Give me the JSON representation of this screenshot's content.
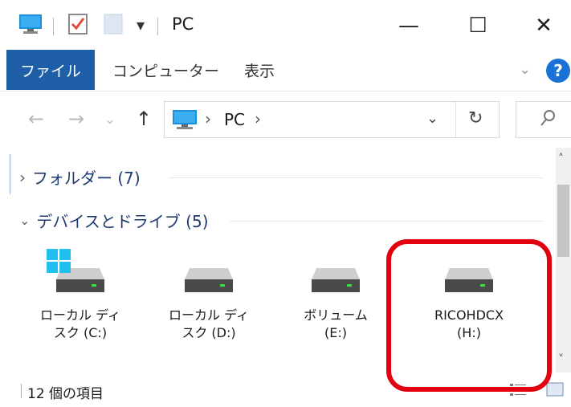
{
  "window": {
    "title": "PC"
  },
  "titlebar_icons": [
    "computer-icon",
    "properties-check-icon",
    "new-folder-icon",
    "quick-access-dropdown-icon"
  ],
  "window_buttons": {
    "minimize": "—",
    "maximize": "☐",
    "close": "✕"
  },
  "ribbon": {
    "tabs": [
      "ファイル",
      "コンピューター",
      "表示"
    ],
    "help": "?"
  },
  "address": {
    "root_icon": "computer-icon",
    "crumbs": [
      "PC"
    ],
    "separator": "›"
  },
  "groups": [
    {
      "label": "フォルダー (7)",
      "expanded": false
    },
    {
      "label": "デバイスとドライブ (5)",
      "expanded": true
    }
  ],
  "drives": [
    {
      "line1": "ローカル ディ",
      "line2": "スク (C:)",
      "windows_logo": true
    },
    {
      "line1": "ローカル ディ",
      "line2": "スク (D:)",
      "windows_logo": false
    },
    {
      "line1": "ボリューム",
      "line2": "(E:)",
      "windows_logo": false
    },
    {
      "line1": "RICOHDCX",
      "line2": "(H:)",
      "windows_logo": false
    }
  ],
  "status": {
    "item_count": "12 個の項目"
  },
  "colors": {
    "file_tab": "#1f5fa8",
    "highlight": "#e3000f",
    "group_text": "#1e3a70"
  }
}
